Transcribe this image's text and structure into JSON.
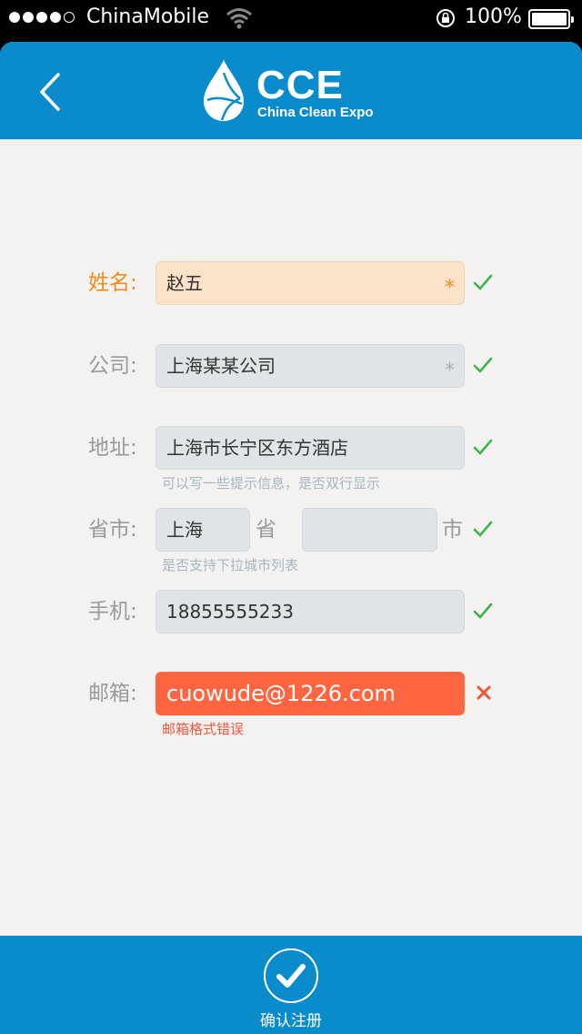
{
  "status_bar": {
    "carrier": "ChinaMobile",
    "battery": "100%"
  },
  "header": {
    "logo_title": "CCE",
    "logo_subtitle": "China Clean Expo"
  },
  "form": {
    "name": {
      "label": "姓名:",
      "value": "赵五",
      "required": "*"
    },
    "company": {
      "label": "公司:",
      "value": "上海某某公司",
      "required": "*"
    },
    "address": {
      "label": "地址:",
      "value": "上海市长宁区东方酒店",
      "hint": "可以写一些提示信息，是否双行显示"
    },
    "province_city": {
      "label": "省市:",
      "province_value": "上海",
      "province_unit": "省",
      "city_value": "",
      "city_unit": "市",
      "hint": "是否支持下拉城市列表"
    },
    "phone": {
      "label": "手机:",
      "value": "18855555233"
    },
    "email": {
      "label": "邮箱:",
      "value": "cuowude@1226.com",
      "error": "邮箱格式错误"
    }
  },
  "footer": {
    "submit_label": "确认注册"
  },
  "colors": {
    "brand_blue": "#0a8bcb",
    "active_orange": "#f08c1e",
    "error_red": "#ff6540",
    "valid_green": "#3bb54a"
  }
}
